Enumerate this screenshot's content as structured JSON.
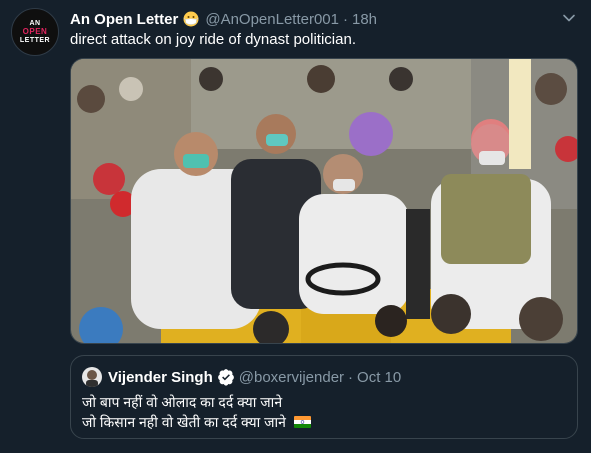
{
  "tweet": {
    "author_name": "An Open Letter",
    "author_handle": "@AnOpenLetter001",
    "separator": "·",
    "time": "18h",
    "text": "direct attack on joy ride of dynast politician.",
    "avatar": {
      "line1": "AN",
      "line2": "OPEN",
      "line3": "LETTER"
    },
    "icons": {
      "emoji": "face-with-medical-mask-icon",
      "menu": "chevron-down-icon"
    }
  },
  "quoted_tweet": {
    "author_name": "Vijender Singh",
    "author_handle": "@boxervijender",
    "separator": "·",
    "date": "Oct 10",
    "line1": "जो बाप नहीं वो ओलाद का दर्द क्या जाने",
    "line2": "जो किसान नही वो खेती का दर्द क्या जाने",
    "icons": {
      "verified": "verified-badge-icon",
      "flag": "india-flag-icon"
    }
  },
  "colors": {
    "background": "#15202b",
    "secondary_text": "#8899a6",
    "border": "#38444d",
    "verified": "#1da1f2",
    "accent_red": "#e0245e"
  }
}
